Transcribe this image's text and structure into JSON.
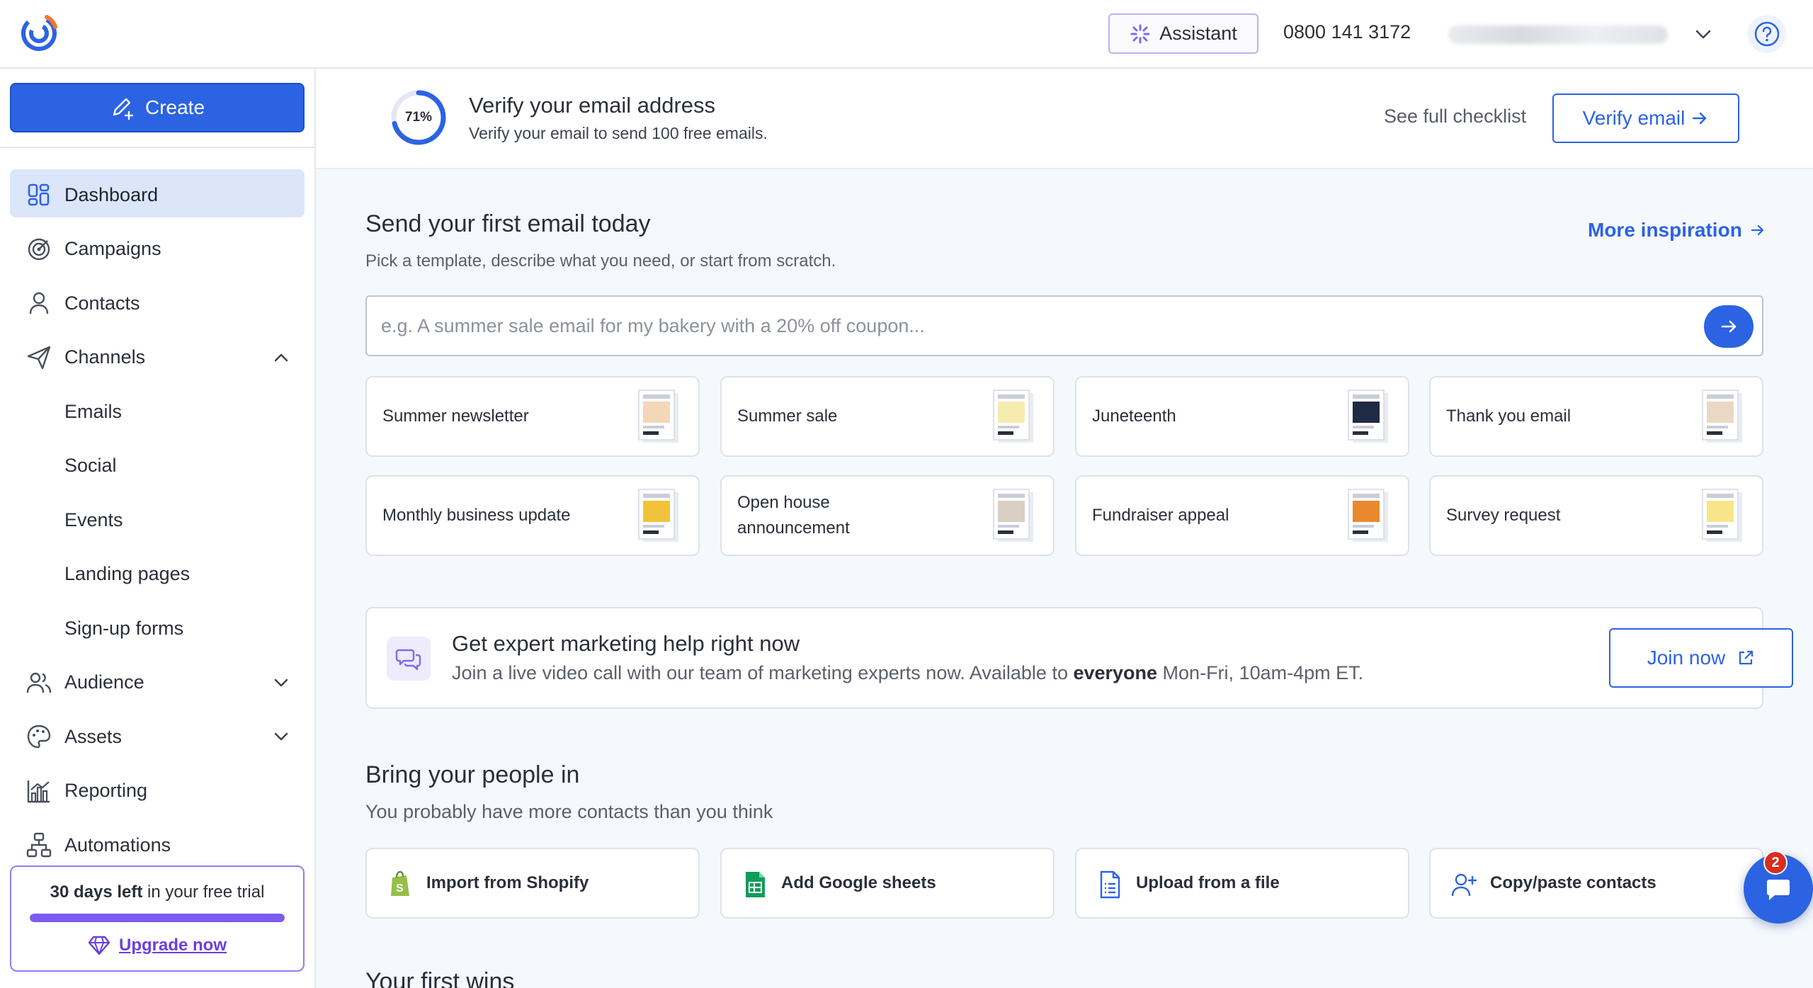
{
  "header": {
    "assistant_label": "Assistant",
    "phone": "0800 141 3172"
  },
  "sidebar": {
    "create_label": "Create",
    "items": [
      {
        "label": "Dashboard",
        "icon": "dashboard-icon",
        "active": true
      },
      {
        "label": "Campaigns",
        "icon": "target-icon"
      },
      {
        "label": "Contacts",
        "icon": "person-icon"
      },
      {
        "label": "Channels",
        "icon": "paper-plane-icon",
        "expanded": true
      },
      {
        "label": "Emails",
        "sub": true
      },
      {
        "label": "Social",
        "sub": true
      },
      {
        "label": "Events",
        "sub": true
      },
      {
        "label": "Landing pages",
        "sub": true
      },
      {
        "label": "Sign-up forms",
        "sub": true
      },
      {
        "label": "Audience",
        "icon": "people-icon",
        "expanded": false
      },
      {
        "label": "Assets",
        "icon": "palette-icon",
        "expanded": false
      },
      {
        "label": "Reporting",
        "icon": "bar-chart-icon"
      },
      {
        "label": "Automations",
        "icon": "flow-icon"
      }
    ],
    "trial": {
      "days_bold": "30 days left",
      "rest": " in your free trial",
      "progress": 1.0,
      "upgrade_label": "Upgrade now"
    }
  },
  "verify": {
    "percent": "71%",
    "percent_value": 0.71,
    "title": "Verify your email address",
    "subtitle": "Verify your email to send 100 free emails.",
    "checklist_label": "See full checklist",
    "button_label": "Verify email"
  },
  "send": {
    "title": "Send your first email today",
    "subtitle": "Pick a template, describe what you need, or start from scratch.",
    "more_label": "More inspiration",
    "placeholder": "e.g. A summer sale email for my bakery with a 20% off coupon...",
    "templates": [
      {
        "label": "Summer newsletter",
        "thumb": "#f4d6b8"
      },
      {
        "label": "Summer sale",
        "thumb": "#f6ecb0"
      },
      {
        "label": "Juneteenth",
        "thumb": "#1f2a44"
      },
      {
        "label": "Thank you email",
        "thumb": "#e9d9c4"
      },
      {
        "label": "Monthly business update",
        "thumb": "#f2c33a"
      },
      {
        "label": "Open house announcement",
        "thumb": "#d9cfc3"
      },
      {
        "label": "Fundraiser appeal",
        "thumb": "#e8892f"
      },
      {
        "label": "Survey request",
        "thumb": "#f7e58a"
      }
    ]
  },
  "help": {
    "title": "Get expert marketing help right now",
    "sub_before": "Join a live video call with our team of marketing experts now. Available to ",
    "sub_bold": "everyone",
    "sub_after": " Mon-Fri, 10am-4pm ET.",
    "join_label": "Join now"
  },
  "people": {
    "title": "Bring your people in",
    "subtitle": "You probably have more contacts than you think",
    "imports": [
      {
        "label": "Import from Shopify",
        "icon": "shopify-icon"
      },
      {
        "label": "Add Google sheets",
        "icon": "google-sheets-icon"
      },
      {
        "label": "Upload from a file",
        "icon": "file-icon"
      },
      {
        "label": "Copy/paste contacts",
        "icon": "add-person-icon"
      }
    ]
  },
  "wins": {
    "title": "Your first wins"
  },
  "chat": {
    "badge": "2"
  },
  "colors": {
    "brand_blue": "#2b63e2",
    "active_nav_bg": "#dbe6fb",
    "trial_purple": "#7b5cf0",
    "page_bg": "#f5f8fd"
  }
}
